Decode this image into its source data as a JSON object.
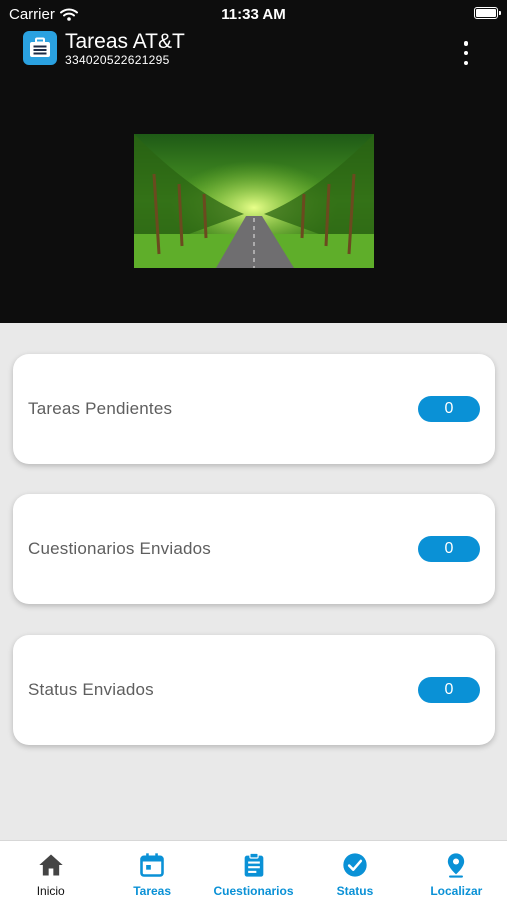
{
  "status_bar": {
    "carrier": "Carrier",
    "time": "11:33 AM"
  },
  "app_bar": {
    "title": "Tareas AT&T",
    "subtitle": "334020522621295"
  },
  "cards": [
    {
      "label": "Tareas Pendientes",
      "count": "0"
    },
    {
      "label": "Cuestionarios Enviados",
      "count": "0"
    },
    {
      "label": "Status Enviados",
      "count": "0"
    }
  ],
  "tabs": [
    {
      "label": "Inicio",
      "icon": "home-icon"
    },
    {
      "label": "Tareas",
      "icon": "calendar-icon"
    },
    {
      "label": "Cuestionarios",
      "icon": "clipboard-icon"
    },
    {
      "label": "Status",
      "icon": "check-circle-icon"
    },
    {
      "label": "Localizar",
      "icon": "location-pin-icon"
    }
  ],
  "colors": {
    "header_bg": "#0d0d0d",
    "accent": "#0a91d6",
    "page_bg": "#e9e9e9",
    "tab_active": "#333333"
  }
}
